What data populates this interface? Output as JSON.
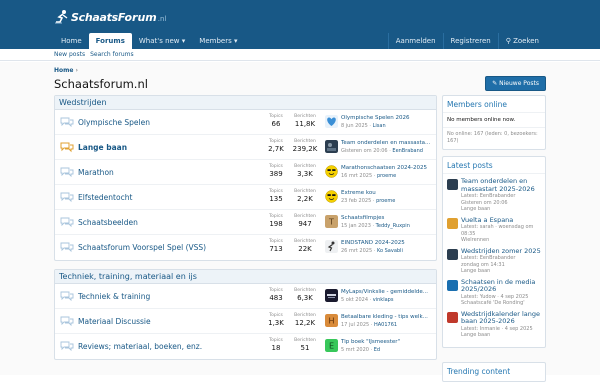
{
  "header": {
    "logo_part1": "Schaats",
    "logo_part2": "Forum",
    "logo_part3": ".nl"
  },
  "nav": {
    "items": [
      {
        "label": "Home"
      },
      {
        "label": "Forums"
      },
      {
        "label": "What's new ▾"
      },
      {
        "label": "Members ▾"
      }
    ],
    "right": [
      {
        "label": "Aanmelden"
      },
      {
        "label": "Registreren"
      },
      {
        "label": "Zoeken"
      }
    ]
  },
  "subnav": [
    "New posts",
    "Search forums"
  ],
  "breadcrumb": "Home",
  "page_title": "Schaatsforum.nl",
  "new_posts_button": "Nieuwe Posts",
  "stat_labels": {
    "topics": "Topics",
    "berichten": "Berichten"
  },
  "categories": [
    {
      "title": "Wedstrijden",
      "nodes": [
        {
          "title": "Olympische Spelen",
          "unread": false,
          "topics": "66",
          "posts": "11,8K",
          "last_title": "Olympische Spelen 2026",
          "last_date": "8 jun 2025",
          "last_user": "Lisan",
          "avatar_color": "#3a8fd6",
          "avatar_char": "♥"
        },
        {
          "title": "Lange baan",
          "unread": true,
          "topics": "2,7K",
          "posts": "239,2K",
          "last_title": "Team onderdelen en massasta...",
          "last_date": "Gisteren om 20:06",
          "last_user": "EenBraband",
          "avatar_color": "#2c3e50",
          "avatar_char": ""
        },
        {
          "title": "Marathon",
          "unread": false,
          "topics": "389",
          "posts": "3,3K",
          "last_title": "Marathonschaatsen 2024-2025",
          "last_date": "16 mrt 2025",
          "last_user": "proeme",
          "avatar_color": "#f5d000",
          "avatar_char": "☺"
        },
        {
          "title": "Elfstedentocht",
          "unread": false,
          "topics": "135",
          "posts": "2,2K",
          "last_title": "Extreme kou",
          "last_date": "23 feb 2025",
          "last_user": "proeme",
          "avatar_color": "#f5d000",
          "avatar_char": "☺"
        },
        {
          "title": "Schaatsbeelden",
          "unread": false,
          "topics": "198",
          "posts": "947",
          "last_title": "Schaatsfilmpjes",
          "last_date": "15 jan 2023",
          "last_user": "Teddy_Ruxpin",
          "avatar_color": "#c9a26b",
          "avatar_char": "T"
        },
        {
          "title": "Schaatsforum Voorspel Spel (VSS)",
          "unread": false,
          "topics": "713",
          "posts": "22K",
          "last_title": "EINDSTAND 2024-2025",
          "last_date": "26 mrt 2025",
          "last_user": "Ko Savabli",
          "avatar_color": "#d0d0d0",
          "avatar_char": ""
        }
      ]
    },
    {
      "title": "Techniek, training, materiaal en ijs",
      "nodes": [
        {
          "title": "Techniek & training",
          "unread": false,
          "topics": "483",
          "posts": "6,3K",
          "last_title": "MyLaps/Vinkslie - gemiddelde...",
          "last_date": "5 okt 2024",
          "last_user": "vinklaps",
          "avatar_color": "#1a1a2e",
          "avatar_char": ""
        },
        {
          "title": "Materiaal Discussie",
          "unread": false,
          "topics": "1,3K",
          "posts": "12,2K",
          "last_title": "Betaalbare kleding - tips welk...",
          "last_date": "17 jul 2025",
          "last_user": "HA01761",
          "avatar_color": "#d98b3a",
          "avatar_char": "H"
        },
        {
          "title": "Reviews; materiaal, boeken, enz.",
          "unread": false,
          "topics": "18",
          "posts": "51",
          "last_title": "Tip boek \"IJsmeester\"",
          "last_date": "5 mrt 2020",
          "last_user": "Ed",
          "avatar_color": "#38c75a",
          "avatar_char": "E"
        }
      ]
    }
  ],
  "sidebar": {
    "members_online": {
      "title": "Members online",
      "none_text": "No members online now.",
      "footer": "No online: 167 (leden: 0, bezoekers: 167)"
    },
    "latest_posts": {
      "title": "Latest posts",
      "items": [
        {
          "title": "Team onderdelen en massastart 2025-2026",
          "meta1": "Latest: EenBrabander",
          "meta2": "Gisteren om 20:06",
          "meta3": "Lange baan",
          "color": "#2c3e50"
        },
        {
          "title": "Vuelta a Espana",
          "meta1": "Latest: sarah · woensdag om",
          "meta2": "08:35",
          "meta3": "Wielrennen",
          "color": "#e0a030"
        },
        {
          "title": "Wedstrijden zomer 2025",
          "meta1": "Latest: EenBrabander",
          "meta2": "zondag om 14:31",
          "meta3": "Lange baan",
          "color": "#2c3e50"
        },
        {
          "title": "Schaatsen in de media 2025/2026",
          "meta1": "Latest: Yudow · 4 sep 2025",
          "meta2": "Schaatscafé 'De Ronding'",
          "meta3": "",
          "color": "#1a6fb0"
        },
        {
          "title": "Wedstrijdkalender lange baan 2025-2026",
          "meta1": "Latest: Inmanie · 4 sep 2025",
          "meta2": "Lange baan",
          "meta3": "",
          "color": "#c0392b"
        }
      ]
    },
    "trending_title": "Trending content"
  }
}
